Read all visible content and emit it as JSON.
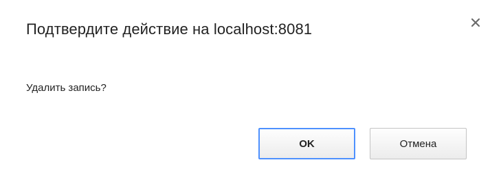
{
  "dialog": {
    "title": "Подтвердите действие на localhost:8081",
    "message": "Удалить запись?",
    "close_icon": "close-icon",
    "ok_label": "OK",
    "cancel_label": "Отмена"
  },
  "colors": {
    "background": "#ffffff",
    "text": "#222222",
    "focus_border": "#4d90fe",
    "button_border": "#c3c3c3",
    "close_icon": "#6b6b6b"
  }
}
